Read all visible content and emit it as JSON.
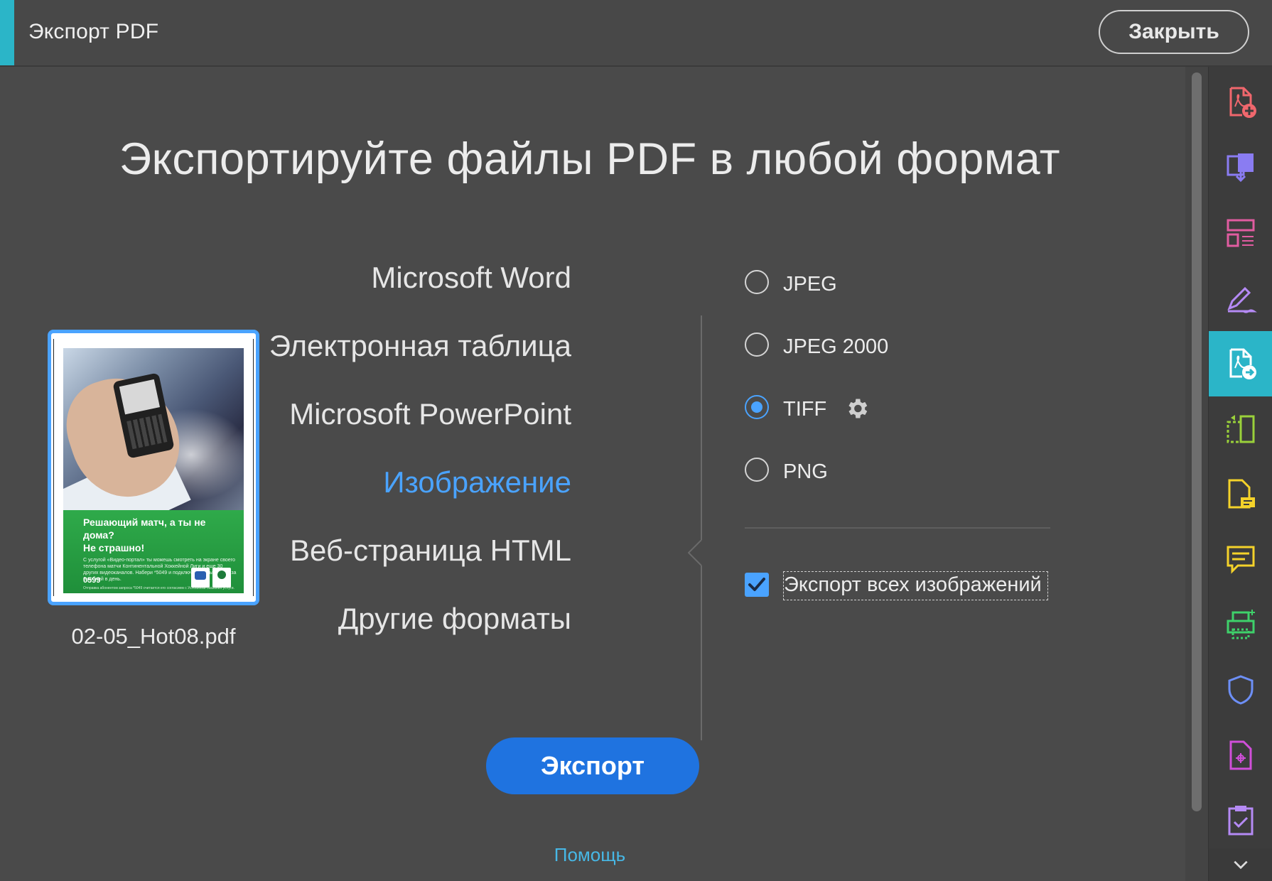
{
  "window": {
    "title": "Экспорт PDF",
    "close_label": "Закрыть"
  },
  "main": {
    "headline": "Экспортируйте файлы PDF в любой формат",
    "filename": "02-05_Hot08.pdf",
    "thumbnail": {
      "promo_title_1": "Решающий матч, а ты не дома?",
      "promo_title_2": "Не страшно!",
      "promo_text": "С услугой «Видео-портал» ты можешь смотреть на экране своего телефона матчи Континентальной Хоккейной Лиги и еще 30 других видеоканалов. Набери *5049 и подключи базовый пакет за 6 рублей в день.",
      "promo_small": "Отправка абонентом запроса *5049 считается его согласием с Условиями оказания услуги.",
      "brand": "0599"
    },
    "formats": [
      {
        "label": "Microsoft Word",
        "active": false
      },
      {
        "label": "Электронная таблица",
        "active": false
      },
      {
        "label": "Microsoft PowerPoint",
        "active": false
      },
      {
        "label": "Изображение",
        "active": true
      },
      {
        "label": "Веб-страница HTML",
        "active": false
      },
      {
        "label": "Другие форматы",
        "active": false
      }
    ],
    "image_options": [
      {
        "label": "JPEG",
        "checked": false
      },
      {
        "label": "JPEG 2000",
        "checked": false
      },
      {
        "label": "TIFF",
        "checked": true
      },
      {
        "label": "PNG",
        "checked": false
      }
    ],
    "export_all_images_label": "Экспорт всех изображений",
    "export_all_images_checked": true,
    "export_button": "Экспорт",
    "help_link": "Помощь"
  },
  "tools": [
    {
      "name": "create-pdf-icon",
      "color": "#f0676d"
    },
    {
      "name": "combine-files-icon",
      "color": "#8a7cf2"
    },
    {
      "name": "organize-pages-icon",
      "color": "#e15ca0"
    },
    {
      "name": "fill-sign-icon",
      "color": "#b58af5"
    },
    {
      "name": "export-pdf-icon",
      "color": "#ffffff"
    },
    {
      "name": "scan-ocr-icon",
      "color": "#9ad13a"
    },
    {
      "name": "send-review-icon",
      "color": "#f4d22a"
    },
    {
      "name": "comment-icon",
      "color": "#f4d22a"
    },
    {
      "name": "print-production-icon",
      "color": "#3ed16a"
    },
    {
      "name": "protect-icon",
      "color": "#6d8ff7"
    },
    {
      "name": "compare-files-icon",
      "color": "#d04fd9"
    },
    {
      "name": "certificates-icon",
      "color": "#b58af5"
    }
  ],
  "colors": {
    "accent": "#2bb5c8",
    "active_blue": "#4aa3ff",
    "export_button": "#1f73e0",
    "help_link": "#47b8e6"
  }
}
